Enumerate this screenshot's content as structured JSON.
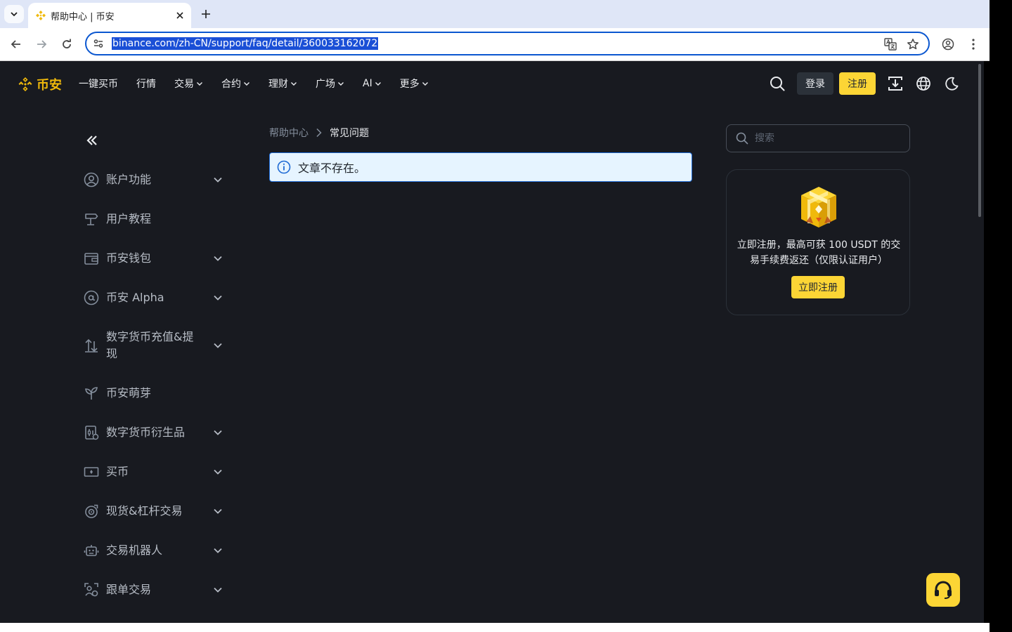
{
  "browser": {
    "tab_title": "帮助中心 | 币安",
    "url": "binance.com/zh-CN/support/faq/detail/360033162072",
    "icons": [
      "tab-search-icon",
      "favicon",
      "close-icon",
      "plus-icon",
      "back-icon",
      "forward-icon",
      "reload-icon",
      "site-info-icon",
      "translate-icon",
      "star-icon",
      "profile-icon",
      "kebab-menu-icon"
    ],
    "accent_color": "#0b57d0"
  },
  "header": {
    "logo_text": "币安",
    "menu": [
      {
        "label": "一键买币",
        "has_dropdown": false
      },
      {
        "label": "行情",
        "has_dropdown": false
      },
      {
        "label": "交易",
        "has_dropdown": true
      },
      {
        "label": "合约",
        "has_dropdown": true
      },
      {
        "label": "理财",
        "has_dropdown": true
      },
      {
        "label": "广场",
        "has_dropdown": true
      },
      {
        "label": "AI",
        "has_dropdown": true
      },
      {
        "label": "更多",
        "has_dropdown": true
      }
    ],
    "login_label": "登录",
    "register_label": "注册",
    "icons": [
      "search-icon",
      "download-icon",
      "globe-icon",
      "moon-icon"
    ]
  },
  "sidebar": {
    "items": [
      {
        "label": "账户功能",
        "icon": "user-circle-icon",
        "expandable": true
      },
      {
        "label": "用户教程",
        "icon": "signpost-icon",
        "expandable": false
      },
      {
        "label": "币安钱包",
        "icon": "wallet-icon",
        "expandable": true
      },
      {
        "label": "币安 Alpha",
        "icon": "at-sign-icon",
        "expandable": true
      },
      {
        "label": "数字货币充值&提现",
        "icon": "deposit-icon",
        "expandable": true
      },
      {
        "label": "币安萌芽",
        "icon": "sprout-icon",
        "expandable": false
      },
      {
        "label": "数字货币衍生品",
        "icon": "derivatives-icon",
        "expandable": true
      },
      {
        "label": "买币",
        "icon": "cash-icon",
        "expandable": true
      },
      {
        "label": "现货&杠杆交易",
        "icon": "spot-margin-icon",
        "expandable": true
      },
      {
        "label": "交易机器人",
        "icon": "robot-icon",
        "expandable": true
      },
      {
        "label": "跟单交易",
        "icon": "copy-trading-icon",
        "expandable": true
      }
    ]
  },
  "breadcrumb": {
    "home": "帮助中心",
    "current": "常见问题"
  },
  "alert": {
    "message": "文章不存在。"
  },
  "search": {
    "placeholder": "搜索"
  },
  "promo": {
    "text": "立即注册，最高可获 100 USDT 的交易手续费返还（仅限认证用户）",
    "button_label": "立即注册"
  },
  "colors": {
    "page_bg": "#181a20",
    "brand_yellow": "#fcd535",
    "logo_yellow": "#f0b90b",
    "text_primary": "#eaecef",
    "text_secondary": "#b7bdc6",
    "alert_bg": "#e6f4ff",
    "alert_border": "#1e6ad4"
  }
}
